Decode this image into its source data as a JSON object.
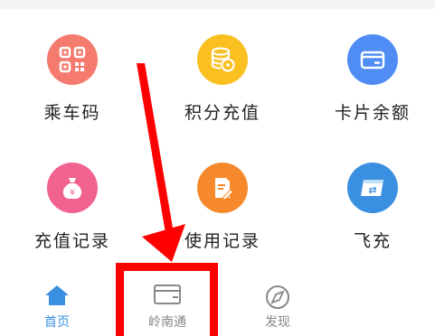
{
  "grid": {
    "items": [
      {
        "label": "乘车码",
        "color": "#f47b6e",
        "icon": "qr-code-icon"
      },
      {
        "label": "积分充值",
        "color": "#f9c020",
        "icon": "coin-stack-icon"
      },
      {
        "label": "卡片余额",
        "color": "#4f8df5",
        "icon": "card-icon"
      },
      {
        "label": "充值记录",
        "color": "#f2628f",
        "icon": "money-bag-icon"
      },
      {
        "label": "使用记录",
        "color": "#f5892b",
        "icon": "document-edit-icon"
      },
      {
        "label": "飞充",
        "color": "#3a8fe0",
        "icon": "swap-icon"
      }
    ]
  },
  "nav": {
    "items": [
      {
        "label": "首页",
        "icon": "home-icon",
        "active": true,
        "color": "#3a8fe0"
      },
      {
        "label": "岭南通",
        "icon": "card-icon",
        "active": false,
        "color": "#888888"
      },
      {
        "label": "发现",
        "icon": "compass-icon",
        "active": false,
        "color": "#888888"
      }
    ]
  },
  "annotation": {
    "color": "#ff0000"
  }
}
